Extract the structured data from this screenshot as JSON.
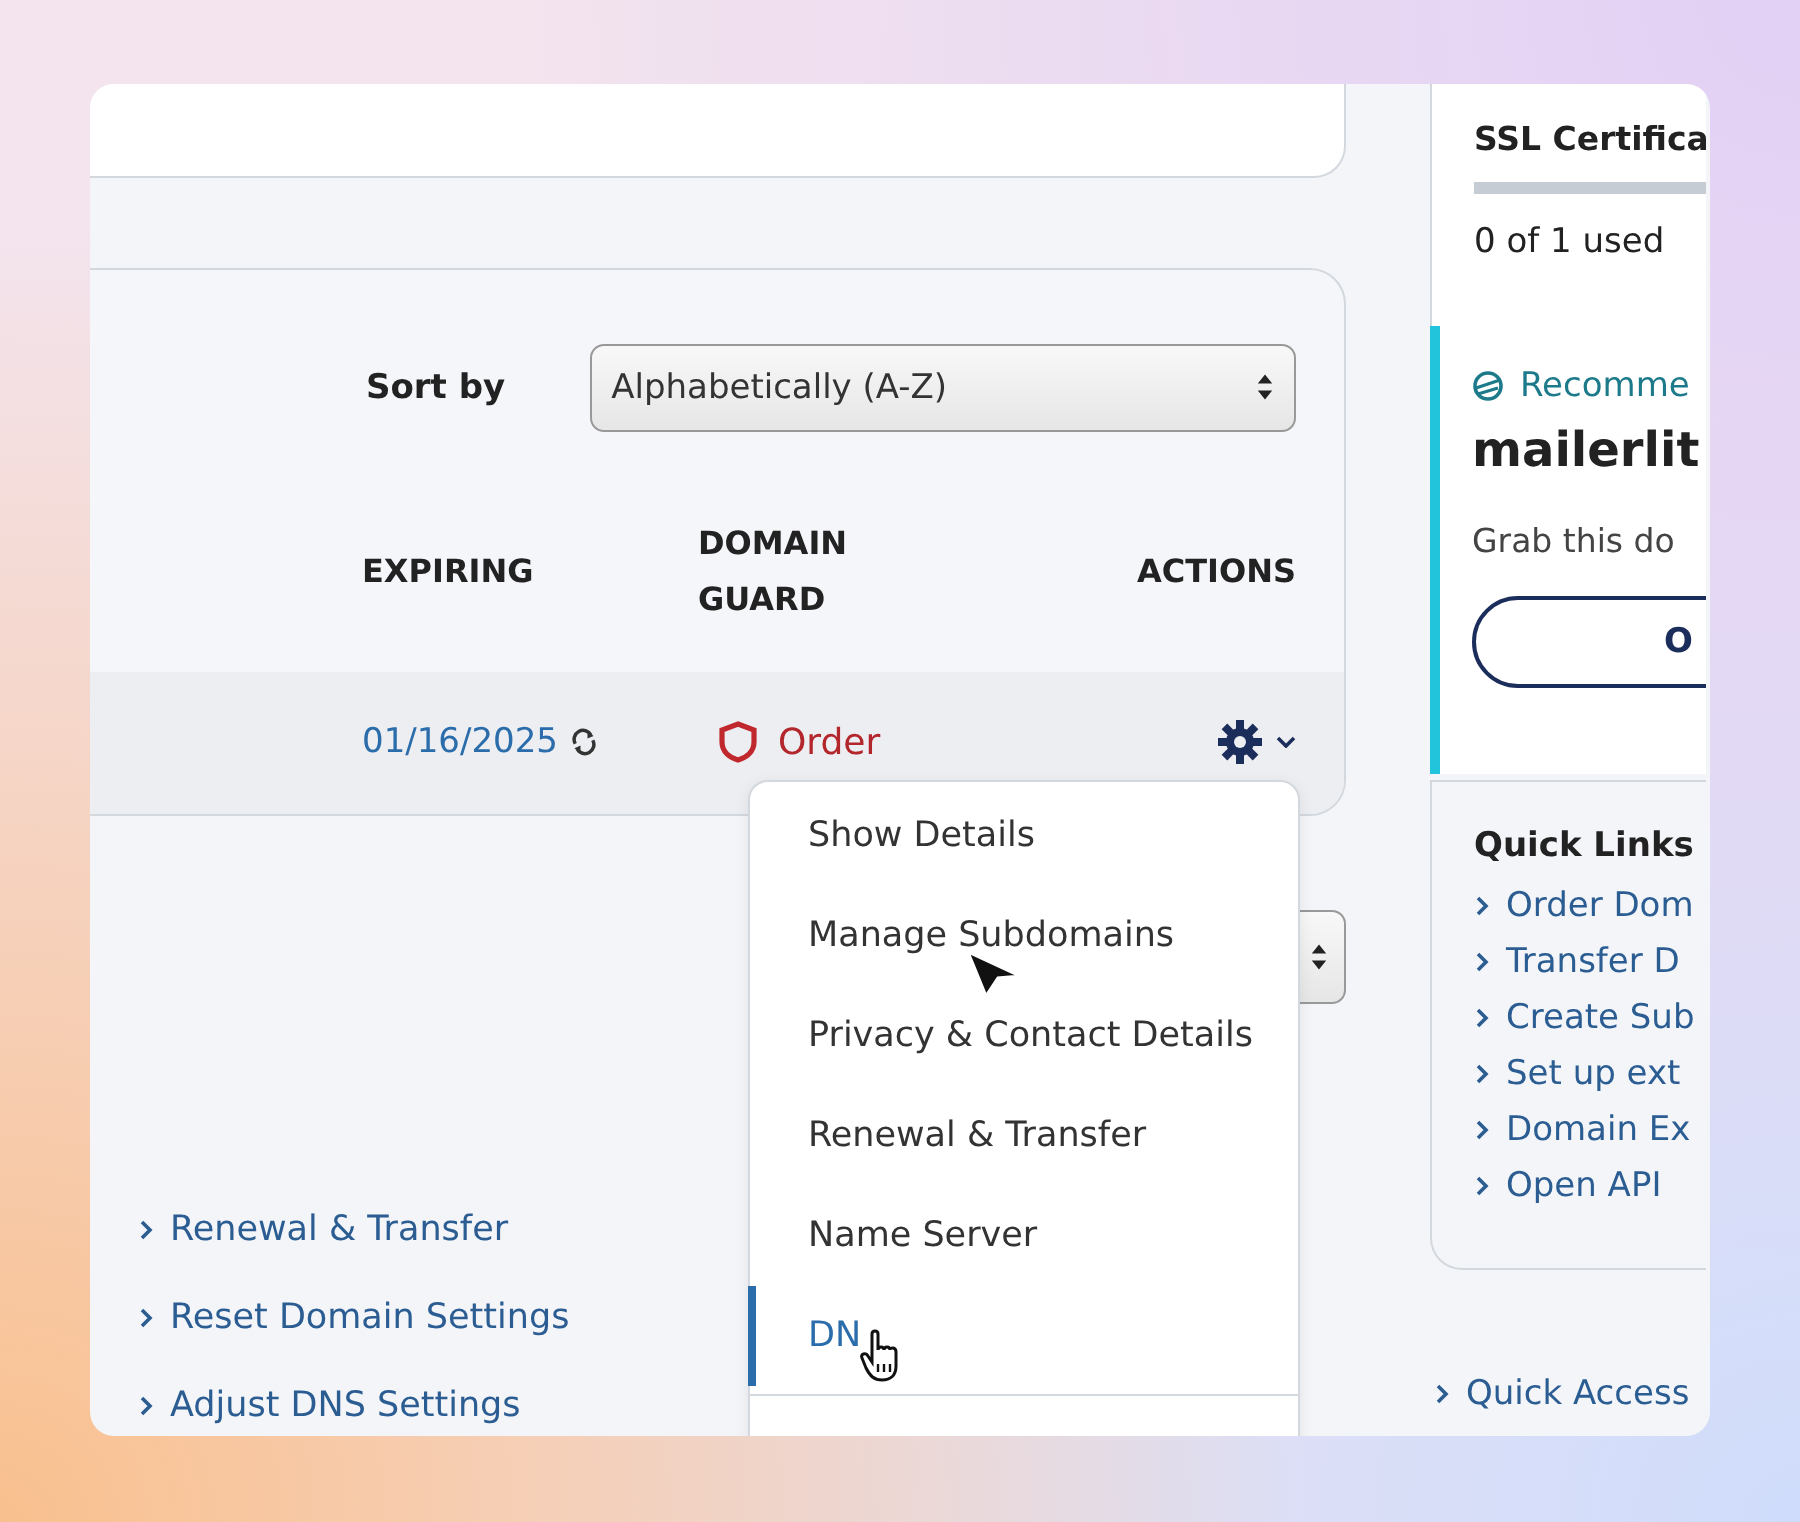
{
  "sort": {
    "label": "Sort by",
    "value": "Alphabetically (A-Z)"
  },
  "table": {
    "columns": [
      "EXPIRING",
      "DOMAIN GUARD",
      "ACTIONS"
    ],
    "rows": [
      {
        "expiring": "01/16/2025",
        "domain_guard": "Order"
      }
    ]
  },
  "action_menu": {
    "items": [
      {
        "label": "Show Details",
        "selected": false
      },
      {
        "label": "Manage Subdomains",
        "selected": false
      },
      {
        "label": "Privacy & Contact Details",
        "selected": false
      },
      {
        "label": "Renewal & Transfer",
        "selected": false
      },
      {
        "label": "Name Server",
        "selected": false
      },
      {
        "label": "DN",
        "selected": true
      }
    ]
  },
  "links": [
    "Renewal & Transfer",
    "Reset Domain Settings",
    "Adjust DNS Settings"
  ],
  "ssl": {
    "title": "SSL Certifica",
    "usage": "0 of 1 used"
  },
  "recommendation": {
    "label": "Recomme",
    "domain": "mailerlit",
    "text": "Grab this do",
    "button": "O"
  },
  "quick_links": {
    "title": "Quick Links",
    "items": [
      "Order Dom",
      "Transfer D",
      "Create Sub",
      "Set up ext",
      "Domain Ex",
      "Open API"
    ]
  },
  "quick_access": "Quick Access"
}
